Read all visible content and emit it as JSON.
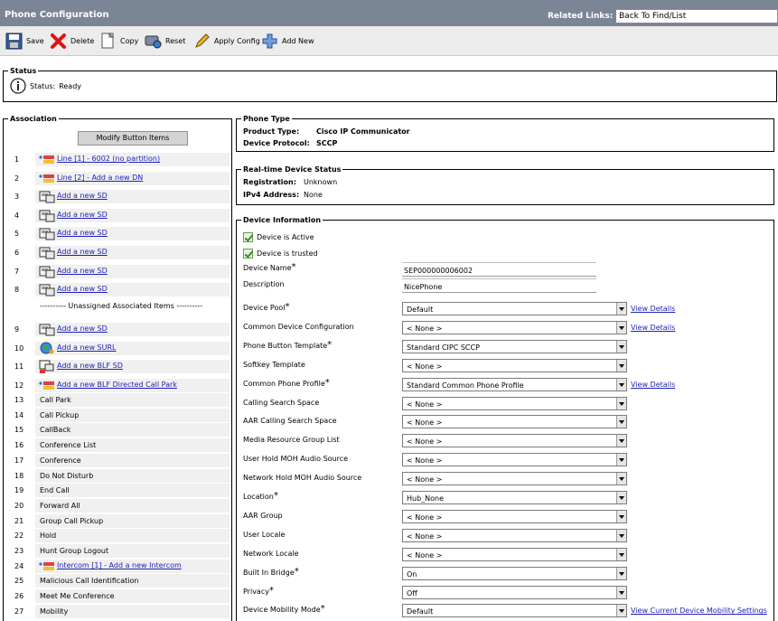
{
  "header": {
    "title": "Phone Configuration",
    "related_links_label": "Related Links:",
    "related_links_value": "Back To Find/List"
  },
  "toolbar": {
    "save": "Save",
    "delete": "Delete",
    "copy": "Copy",
    "reset": "Reset",
    "apply_config": "Apply Config",
    "add_new": "Add New"
  },
  "status": {
    "legend": "Status",
    "label": "Status:",
    "value": "Ready"
  },
  "association": {
    "legend": "Association",
    "modify_button": "Modify Button Items",
    "unassigned_label": "---------- Unassigned Associated Items ----------",
    "rows": [
      {
        "num": "1",
        "text": "Line [1] - 6002 (no partition)",
        "icon": "line-icon",
        "link": true
      },
      {
        "num": "2",
        "text": "Line [2] - Add a new DN",
        "icon": "line-icon",
        "link": true
      },
      {
        "num": "3",
        "text": "Add a new SD",
        "icon": "speed-dial-icon",
        "link": true
      },
      {
        "num": "4",
        "text": "Add a new SD",
        "icon": "speed-dial-icon",
        "link": true
      },
      {
        "num": "5",
        "text": "Add a new SD",
        "icon": "speed-dial-icon",
        "link": true
      },
      {
        "num": "6",
        "text": "Add a new SD",
        "icon": "speed-dial-icon",
        "link": true
      },
      {
        "num": "7",
        "text": "Add a new SD",
        "icon": "speed-dial-icon",
        "link": true
      },
      {
        "num": "8",
        "text": "Add a new SD",
        "icon": "speed-dial-icon",
        "link": true
      },
      {
        "num": "9",
        "text": "Add a new SD",
        "icon": "speed-dial-icon",
        "link": true
      },
      {
        "num": "10",
        "text": "Add a new SURL",
        "icon": "service-url-icon",
        "link": true
      },
      {
        "num": "11",
        "text": "Add a new BLF SD",
        "icon": "blf-speed-dial-icon",
        "link": true
      },
      {
        "num": "12",
        "text": "Add a new BLF Directed Call Park",
        "icon": "line-icon",
        "link": true
      },
      {
        "num": "13",
        "text": "Call Park",
        "link": false
      },
      {
        "num": "14",
        "text": "Call Pickup",
        "link": false
      },
      {
        "num": "15",
        "text": "CallBack",
        "link": false
      },
      {
        "num": "16",
        "text": "Conference List",
        "link": false
      },
      {
        "num": "17",
        "text": "Conference",
        "link": false
      },
      {
        "num": "18",
        "text": "Do Not Disturb",
        "link": false
      },
      {
        "num": "19",
        "text": "End Call",
        "link": false
      },
      {
        "num": "20",
        "text": "Forward All",
        "link": false
      },
      {
        "num": "21",
        "text": "Group Call Pickup",
        "link": false
      },
      {
        "num": "22",
        "text": "Hold",
        "link": false
      },
      {
        "num": "23",
        "text": "Hunt Group Logout",
        "link": false
      },
      {
        "num": "24",
        "text": "Intercom [1] - Add a new Intercom",
        "icon": "line-icon",
        "link": true
      },
      {
        "num": "25",
        "text": "Malicious Call Identification",
        "link": false
      },
      {
        "num": "26",
        "text": "Meet Me Conference",
        "link": false
      },
      {
        "num": "27",
        "text": "Mobility",
        "link": false
      }
    ]
  },
  "phone_type": {
    "legend": "Phone Type",
    "product_type_label": "Product Type:",
    "product_type_value": "Cisco IP Communicator",
    "protocol_label": "Device Protocol:",
    "protocol_value": "SCCP"
  },
  "realtime": {
    "legend": "Real-time Device Status",
    "registration_label": "Registration:",
    "registration_value": "Unknown",
    "ipv4_label": "IPv4 Address:",
    "ipv4_value": "None"
  },
  "device_info": {
    "legend": "Device Information",
    "device_active": "Device is Active",
    "device_trusted": "Device is trusted",
    "device_name_label": "Device Name",
    "device_name_value": "SEP000000006002",
    "description_label": "Description",
    "description_value": "NicePhone",
    "view_details": "View Details",
    "view_mobility": "View Current Device Mobility Settings",
    "fields": [
      {
        "label": "Device Pool",
        "required": true,
        "value": "Default"
      },
      {
        "label": "Common Device Configuration",
        "required": false,
        "value": "< None >"
      },
      {
        "label": "Phone Button Template",
        "required": true,
        "value": "Standard CIPC SCCP"
      },
      {
        "label": "Softkey Template",
        "required": false,
        "value": "< None >"
      },
      {
        "label": "Common Phone Profile",
        "required": true,
        "value": "Standard Common Phone Profile"
      },
      {
        "label": "Calling Search Space",
        "required": false,
        "value": "< None >"
      },
      {
        "label": "AAR Calling Search Space",
        "required": false,
        "value": "< None >"
      },
      {
        "label": "Media Resource Group List",
        "required": false,
        "value": "< None >"
      },
      {
        "label": "User Hold MOH Audio Source",
        "required": false,
        "value": "< None >"
      },
      {
        "label": "Network Hold MOH Audio Source",
        "required": false,
        "value": "< None >"
      },
      {
        "label": "Location",
        "required": true,
        "value": "Hub_None"
      },
      {
        "label": "AAR Group",
        "required": false,
        "value": "< None >"
      },
      {
        "label": "User Locale",
        "required": false,
        "value": "< None >"
      },
      {
        "label": "Network Locale",
        "required": false,
        "value": "< None >"
      },
      {
        "label": "Built In Bridge",
        "required": true,
        "value": "On"
      },
      {
        "label": "Privacy",
        "required": true,
        "value": "Off"
      },
      {
        "label": "Device Mobility Mode",
        "required": true,
        "value": "Default"
      }
    ]
  },
  "required_marker": "*"
}
